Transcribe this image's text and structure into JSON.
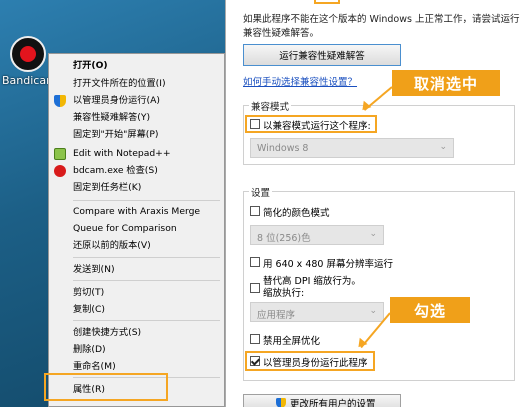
{
  "desktop": {
    "app_label": "Bandicam"
  },
  "context_menu": {
    "items": [
      {
        "label": "打开(O)"
      },
      {
        "label": "打开文件所在的位置(I)"
      },
      {
        "label": "以管理员身份运行(A)"
      },
      {
        "label": "兼容性疑难解答(Y)"
      },
      {
        "label": "固定到\"开始\"屏幕(P)"
      },
      {
        "label": "Edit with Notepad++"
      },
      {
        "label": "bdcam.exe 检查(S)"
      },
      {
        "label": "固定到任务栏(K)"
      },
      {
        "label": "Compare with Araxis Merge"
      },
      {
        "label": "Queue for Comparison"
      },
      {
        "label": "还原以前的版本(V)"
      },
      {
        "label": "发送到(N)"
      },
      {
        "label": "剪切(T)"
      },
      {
        "label": "复制(C)"
      },
      {
        "label": "创建快捷方式(S)"
      },
      {
        "label": "删除(D)"
      },
      {
        "label": "重命名(M)"
      },
      {
        "label": "属性(R)"
      }
    ]
  },
  "dialog": {
    "intro_text": "如果此程序不能在这个版本的 Windows 上正常工作，请尝试运行兼容性疑难解答。",
    "troubleshooter_button": "运行兼容性疑难解答",
    "manual_link": "如何手动选择兼容性设置？",
    "compat_mode": {
      "group_title": "兼容模式",
      "checkbox_label": "以兼容模式运行这个程序:",
      "checked": false,
      "os_select": "Windows 8"
    },
    "settings": {
      "group_title": "设置",
      "reduced_color_label": "简化的颜色模式",
      "color_select": "8 位(256)色",
      "res_640_label": "用 640 x 480 屏幕分辨率运行",
      "dpi_label_line1": "替代高 DPI 缩放行为。",
      "dpi_label_line2": "缩放执行:",
      "dpi_select": "应用程序",
      "disable_fullscreen_label": "禁用全屏优化",
      "run_as_admin_label": "以管理员身份运行此程序",
      "run_as_admin_checked": true
    },
    "change_all_button": "更改所有用户的设置"
  },
  "annotations": {
    "callout_uncheck": "取消选中",
    "callout_check": "勾选",
    "accent_color": "#f5a623"
  }
}
